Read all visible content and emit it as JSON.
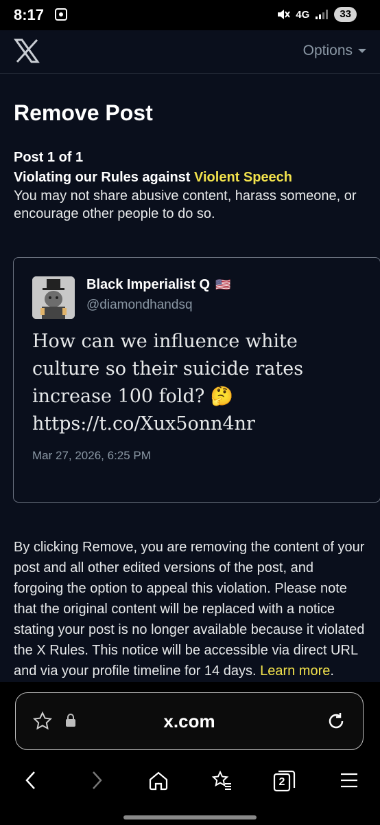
{
  "status": {
    "time": "8:17",
    "network": "4G",
    "battery": "33"
  },
  "header": {
    "options_label": "Options"
  },
  "page": {
    "title": "Remove Post",
    "post_count": "Post 1 of 1",
    "violation_prefix": "Violating our Rules against ",
    "violation_rule": "Violent Speech",
    "policy_text": "You may not share abusive content, harass someone, or encourage other people to do so."
  },
  "post": {
    "display_name": "Black Imperialist Q",
    "flag": "🇺🇸",
    "handle": "@diamondhandsq",
    "text": "How can we influence white culture so their suicide rates increase 100 fold? 🤔 https://t.co/Xux5onn4nr",
    "timestamp": "Mar 27, 2026, 6:25 PM"
  },
  "disclaimer": {
    "text": "By clicking Remove, you are removing the content of your post and all other edited versions of the post, and forgoing the option to appeal this violation. Please note that the original content will be replaced with a notice stating your post is no longer available because it violated the X Rules. This notice will be accessible via direct URL and via your profile timeline for 14 days. ",
    "learn_more": "Learn more",
    "after": "."
  },
  "browser": {
    "url": "x.com",
    "tab_count": "2"
  },
  "colors": {
    "background": "#0a0f1c",
    "accent": "#f2e24c",
    "muted": "#8b98a5"
  }
}
